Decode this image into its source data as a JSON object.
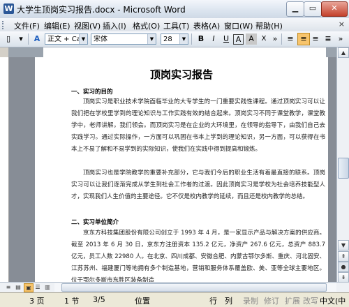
{
  "window": {
    "title": "大学生顶岗实习报告.docx - Microsoft Word",
    "app_icon": "W"
  },
  "menu": {
    "items": [
      "文件(F)",
      "编辑(E)",
      "视图(V)",
      "插入(I)",
      "格式(O)",
      "工具(T)",
      "表格(A)",
      "窗口(W)",
      "帮助(H)"
    ],
    "close_glyph": "×"
  },
  "toolbar": {
    "style_value": "正文 + Car",
    "font_value": "宋体",
    "size_value": "28",
    "bold": "B",
    "italic": "I",
    "underline": "U",
    "char_border": "A",
    "char_scale": "X",
    "align_active": "center"
  },
  "document": {
    "title": "顶岗实习报告",
    "heading1": "一、实习的目的",
    "para1": "顶岗实习是职业技术学院面临毕业的大专学生的一门重要实践性课程。通过顶岗实习可以让我们把在学校里学到的理论知识与工作实践有效的结合起来。顶岗实习不同于课堂教学，课堂教学中，老师讲解，我们领会。而顶岗实习是在企业的大环境里，在领导的指导下，由我们自己去实践学习。通过实际操作，一方面可以巩固在书本上学到的理论知识，另一方面，可以获得在书本上不易了解和不易学到的实际知识，使我们在实践中得到提高和锻炼。",
    "para2": "顶岗实习也是学院教学的重要补充部分，它与我们今后的职业生活有着最直接的联系。顶岗实习可以让我们逐渐完成从学生到社会工作者的过渡。因此顶岗实习是学校为社会培养技能型人才，实现我们人生价值的主要途径。它不仅是校内教学的延续，而且还是校内教学的总结。",
    "heading2": "二、实习单位简介",
    "para3": "京东方科技集团股份有限公司创立于 1993 年 4 月，是一家显示产品与解决方案的供应商。截至 2013 年 6 月 30 日，京东方注册资本 135.2 亿元，净资产 267.6 亿元，总资产 883.7 亿元，员工人数 22980 人。在北京、四川成都、安徽合肥、内蒙古鄂尔多斯、重庆、河北固安、江苏苏州、福建厦门等地拥有多个制造基地，营销和服务体系覆盖欧、美、亚等全球主要地区。位于鄂尔多斯市东胜区装备制造"
  },
  "status": {
    "page": "3 页",
    "section": "1 节",
    "page_of": "3/5",
    "position": "位置",
    "line": "行",
    "col": "列",
    "rec": "录制",
    "trk": "修订",
    "ext": "扩展",
    "ovr": "改写",
    "lang": "中文(中"
  },
  "colors": {
    "titlebar": "#dbe4ef",
    "page_bg": "#ffffff",
    "workspace": "#878d96",
    "active_button": "#f7c46c"
  }
}
